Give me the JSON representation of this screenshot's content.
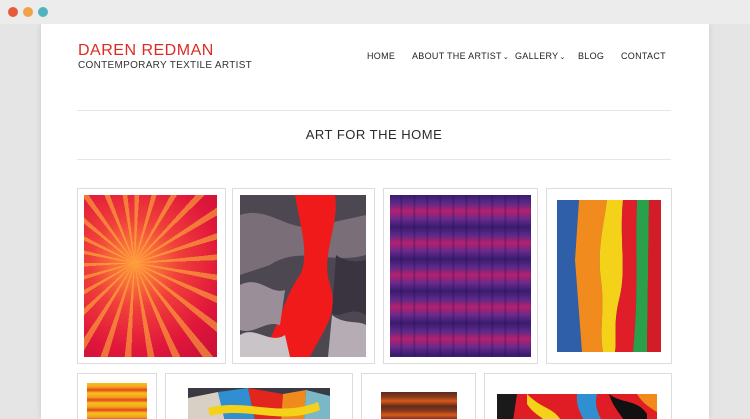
{
  "site": {
    "title": "DAREN REDMAN",
    "tagline": "CONTEMPORARY TEXTILE ARTIST"
  },
  "nav": {
    "items": [
      {
        "label": "HOME"
      },
      {
        "label": "ABOUT THE ARTIST",
        "dropdown": true
      },
      {
        "label": "GALLERY",
        "dropdown": true
      },
      {
        "label": "BLOG"
      },
      {
        "label": "CONTACT"
      }
    ]
  },
  "main": {
    "heading": "ART FOR THE HOME"
  },
  "colors": {
    "brand_red": "#dd2a24"
  }
}
